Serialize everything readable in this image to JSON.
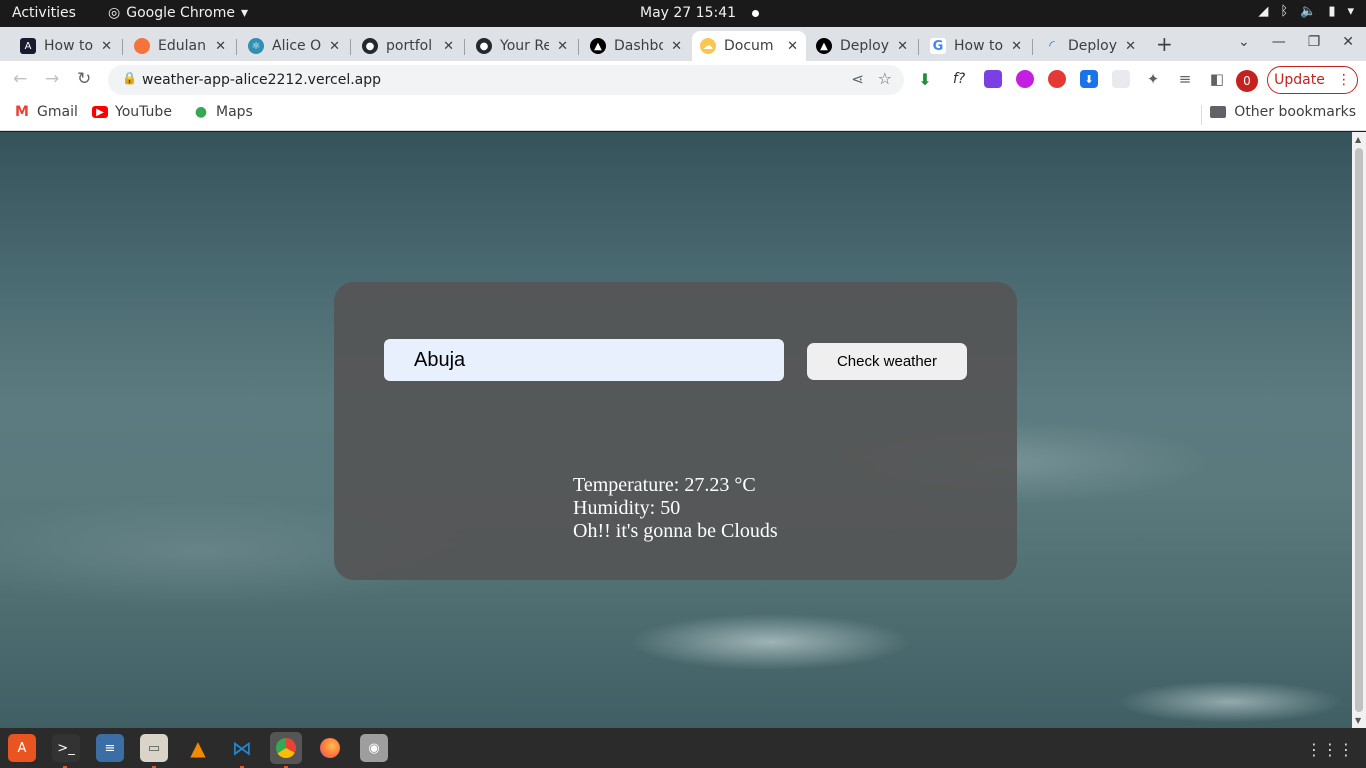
{
  "topbar": {
    "activities": "Activities",
    "app_name": "Google Chrome",
    "clock": "May 27  15:41"
  },
  "tabs": [
    {
      "title": "How to",
      "icon": "angular-icon",
      "color": "#1a1a2e"
    },
    {
      "title": "Edulan",
      "icon": "edulan-icon",
      "color": "#f4743b"
    },
    {
      "title": "Alice O",
      "icon": "react-icon",
      "color": "#2f8fb5"
    },
    {
      "title": "portfol",
      "icon": "github-icon",
      "color": "#24292f"
    },
    {
      "title": "Your Re",
      "icon": "github-icon",
      "color": "#24292f"
    },
    {
      "title": "Dashbo",
      "icon": "vercel-icon",
      "color": "#000000"
    },
    {
      "title": "Docum",
      "icon": "weather-icon",
      "color": "#f9c74f",
      "active": true
    },
    {
      "title": "Deploy",
      "icon": "vercel-icon",
      "color": "#000000"
    },
    {
      "title": "How to",
      "icon": "google-icon",
      "color": "#4285f4"
    },
    {
      "title": "Deploy",
      "icon": "loading-icon",
      "color": "#1a73e8"
    }
  ],
  "toolbar": {
    "url": "weather-app-alice2212.vercel.app",
    "profile_count": "0",
    "update_label": "Update"
  },
  "bookmarks": {
    "items": [
      {
        "label": "Gmail",
        "icon": "gmail-icon"
      },
      {
        "label": "YouTube",
        "icon": "youtube-icon"
      },
      {
        "label": "Maps",
        "icon": "maps-icon"
      }
    ],
    "other": "Other bookmarks"
  },
  "page": {
    "city_value": "Abuja",
    "button_label": "Check weather",
    "temperature": "Temperature: 27.23 °C",
    "humidity": "Humidity: 50",
    "description": "Oh!! it's gonna be Clouds"
  },
  "dock": [
    {
      "name": "software-center-icon",
      "color": "#e95420"
    },
    {
      "name": "terminal-icon",
      "color": "#333333"
    },
    {
      "name": "text-editor-icon",
      "color": "#3b6ea5"
    },
    {
      "name": "files-icon",
      "color": "#d9d4c7"
    },
    {
      "name": "vlc-icon",
      "color": "#f08a00"
    },
    {
      "name": "vscode-icon",
      "color": "#1f8ad2"
    },
    {
      "name": "chrome-icon",
      "color": "#4285f4"
    },
    {
      "name": "firefox-icon",
      "color": "#ff7139"
    },
    {
      "name": "disks-icon",
      "color": "#9e9e9e"
    }
  ]
}
